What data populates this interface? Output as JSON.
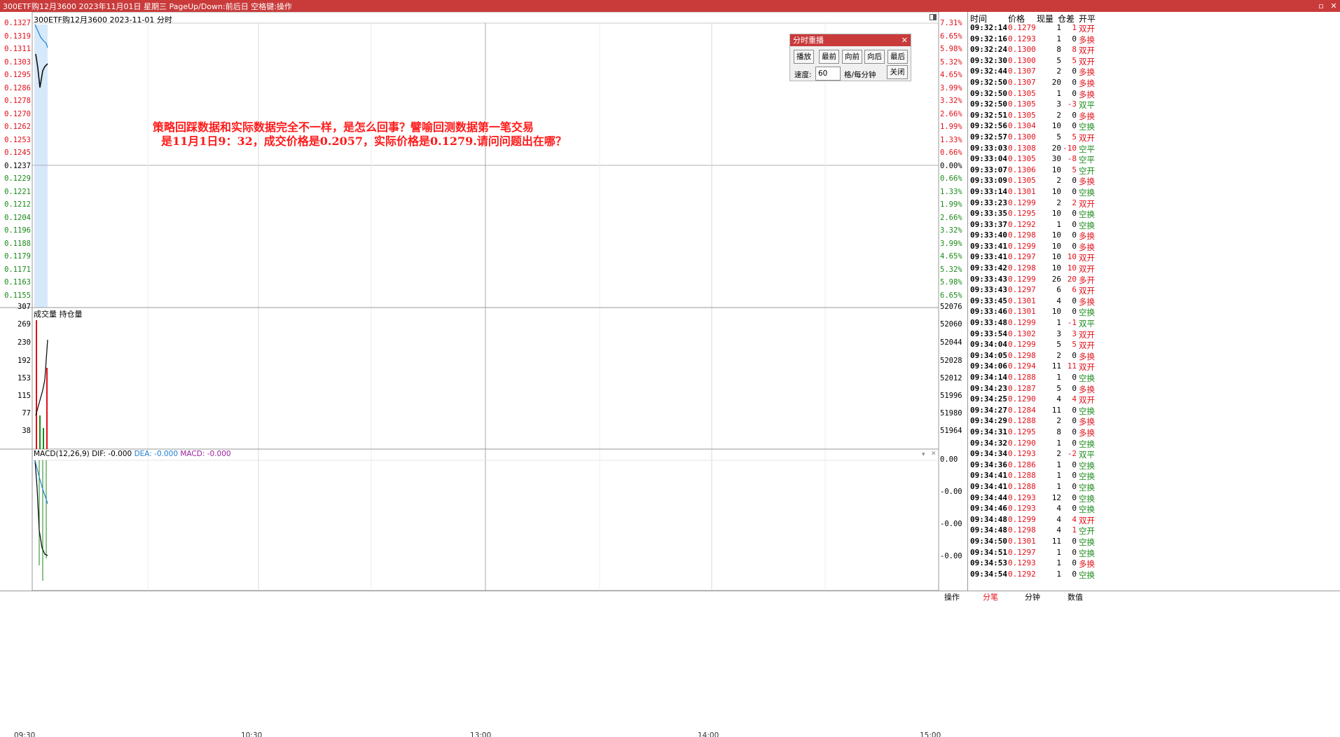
{
  "window": {
    "title": "300ETF购12月3600 2023年11月01日 星期三 PageUp/Down:前后日 空格键:操作",
    "restore_glyph": "▫",
    "close_glyph": "✕"
  },
  "chart_header": {
    "subtitle": "300ETF购12月3600  2023-11-01 分时"
  },
  "annotation": {
    "line1": "策略回踩数据和实际数据完全不一样，是怎么回事？譬喻回测数据第一笔交易",
    "line2": "是11月1日9：32，成交价格是0.2057，实际价格是0.1279.请问问题出在哪？"
  },
  "price_axis": {
    "left": [
      "0.1327",
      "0.1319",
      "0.1311",
      "0.1303",
      "0.1295",
      "0.1286",
      "0.1278",
      "0.1270",
      "0.1262",
      "0.1253",
      "0.1245",
      "0.1237",
      "0.1229",
      "0.1221",
      "0.1212",
      "0.1204",
      "0.1196",
      "0.1188",
      "0.1179",
      "0.1171",
      "0.1163",
      "0.1155"
    ],
    "right": [
      "7.31%",
      "6.65%",
      "5.98%",
      "5.32%",
      "4.65%",
      "3.99%",
      "3.32%",
      "2.66%",
      "1.99%",
      "1.33%",
      "0.66%",
      "0.00%",
      "0.66%",
      "1.33%",
      "1.99%",
      "2.66%",
      "3.32%",
      "3.99%",
      "4.65%",
      "5.32%",
      "5.98%",
      "6.65%"
    ]
  },
  "volume_panel": {
    "label": "成交量   持仓量",
    "left": [
      "307",
      "269",
      "230",
      "192",
      "153",
      "115",
      "77",
      "38"
    ],
    "right": [
      "52076",
      "52060",
      "52044",
      "52028",
      "52012",
      "51996",
      "51980",
      "51964"
    ]
  },
  "macd_panel": {
    "name": "MACD(12,26,9)",
    "dif": "DIF: -0.000",
    "dea": "DEA: -0.000",
    "macd": "MACD: -0.000",
    "right": [
      "0.00",
      "-0.00",
      "-0.00",
      "-0.00"
    ]
  },
  "time_axis": [
    "09:30",
    "10:30",
    "13:00",
    "14:00",
    "15:00"
  ],
  "replay_dialog": {
    "title": "分时重播",
    "buttons": [
      "播放",
      "最前",
      "向前",
      "向后",
      "最后"
    ],
    "speed_label": "速度:",
    "speed_value": "60",
    "unit": "格/每分钟",
    "close_button": "关闭"
  },
  "tick_table": {
    "headers": [
      "时间",
      "价格",
      "现量",
      "仓差",
      "开平"
    ],
    "rows": [
      [
        "09:32:14",
        "0.1279",
        "1",
        "1",
        "双开"
      ],
      [
        "09:32:16",
        "0.1293",
        "1",
        "0",
        "多换"
      ],
      [
        "09:32:24",
        "0.1300",
        "8",
        "8",
        "双开"
      ],
      [
        "09:32:30",
        "0.1300",
        "5",
        "5",
        "双开"
      ],
      [
        "09:32:44",
        "0.1307",
        "2",
        "0",
        "多换"
      ],
      [
        "09:32:50",
        "0.1307",
        "20",
        "0",
        "多换"
      ],
      [
        "09:32:50",
        "0.1305",
        "1",
        "0",
        "多换"
      ],
      [
        "09:32:50",
        "0.1305",
        "3",
        "-3",
        "双平"
      ],
      [
        "09:32:51",
        "0.1305",
        "2",
        "0",
        "多换"
      ],
      [
        "09:32:56",
        "0.1304",
        "10",
        "0",
        "空换"
      ],
      [
        "09:32:57",
        "0.1300",
        "5",
        "5",
        "双开"
      ],
      [
        "09:33:03",
        "0.1308",
        "20",
        "-10",
        "空平"
      ],
      [
        "09:33:04",
        "0.1305",
        "30",
        "-8",
        "空平"
      ],
      [
        "09:33:07",
        "0.1306",
        "10",
        "5",
        "空开"
      ],
      [
        "09:33:09",
        "0.1305",
        "2",
        "0",
        "多换"
      ],
      [
        "09:33:14",
        "0.1301",
        "10",
        "0",
        "空换"
      ],
      [
        "09:33:23",
        "0.1299",
        "2",
        "2",
        "双开"
      ],
      [
        "09:33:35",
        "0.1295",
        "10",
        "0",
        "空换"
      ],
      [
        "09:33:37",
        "0.1292",
        "1",
        "0",
        "空换"
      ],
      [
        "09:33:40",
        "0.1298",
        "10",
        "0",
        "多换"
      ],
      [
        "09:33:41",
        "0.1299",
        "10",
        "0",
        "多换"
      ],
      [
        "09:33:41",
        "0.1297",
        "10",
        "10",
        "双开"
      ],
      [
        "09:33:42",
        "0.1298",
        "10",
        "10",
        "双开"
      ],
      [
        "09:33:43",
        "0.1299",
        "26",
        "20",
        "多开"
      ],
      [
        "09:33:43",
        "0.1297",
        "6",
        "6",
        "双开"
      ],
      [
        "09:33:45",
        "0.1301",
        "4",
        "0",
        "多换"
      ],
      [
        "09:33:46",
        "0.1301",
        "10",
        "0",
        "空换"
      ],
      [
        "09:33:48",
        "0.1299",
        "1",
        "-1",
        "双平"
      ],
      [
        "09:33:54",
        "0.1302",
        "3",
        "3",
        "双开"
      ],
      [
        "09:34:04",
        "0.1299",
        "5",
        "5",
        "双开"
      ],
      [
        "09:34:05",
        "0.1298",
        "2",
        "0",
        "多换"
      ],
      [
        "09:34:06",
        "0.1294",
        "11",
        "11",
        "双开"
      ],
      [
        "09:34:14",
        "0.1288",
        "1",
        "0",
        "空换"
      ],
      [
        "09:34:23",
        "0.1287",
        "5",
        "0",
        "多换"
      ],
      [
        "09:34:25",
        "0.1290",
        "4",
        "4",
        "双开"
      ],
      [
        "09:34:27",
        "0.1284",
        "11",
        "0",
        "空换"
      ],
      [
        "09:34:29",
        "0.1288",
        "2",
        "0",
        "多换"
      ],
      [
        "09:34:31",
        "0.1295",
        "8",
        "0",
        "多换"
      ],
      [
        "09:34:32",
        "0.1290",
        "1",
        "0",
        "空换"
      ],
      [
        "09:34:34",
        "0.1293",
        "2",
        "-2",
        "双平"
      ],
      [
        "09:34:36",
        "0.1286",
        "1",
        "0",
        "空换"
      ],
      [
        "09:34:41",
        "0.1288",
        "1",
        "0",
        "空换"
      ],
      [
        "09:34:41",
        "0.1288",
        "1",
        "0",
        "空换"
      ],
      [
        "09:34:44",
        "0.1293",
        "12",
        "0",
        "空换"
      ],
      [
        "09:34:46",
        "0.1293",
        "4",
        "0",
        "空换"
      ],
      [
        "09:34:48",
        "0.1299",
        "4",
        "4",
        "双开"
      ],
      [
        "09:34:48",
        "0.1298",
        "4",
        "1",
        "空开"
      ],
      [
        "09:34:50",
        "0.1301",
        "11",
        "0",
        "空换"
      ],
      [
        "09:34:51",
        "0.1297",
        "1",
        "0",
        "空换"
      ],
      [
        "09:34:53",
        "0.1293",
        "1",
        "0",
        "多换"
      ],
      [
        "09:34:54",
        "0.1292",
        "1",
        "0",
        "空换"
      ]
    ]
  },
  "bottom_tabs": [
    "操作",
    "分笔",
    "分钟",
    "数值"
  ],
  "colors": {
    "title_bg": "#c93b3b",
    "up": "#e0101a",
    "down": "#1a8a1a",
    "price_line": "#000000",
    "avg_line": "#1e7fd6",
    "dea_color": "#1e7fd6",
    "macd_color": "#9b1fa0"
  }
}
